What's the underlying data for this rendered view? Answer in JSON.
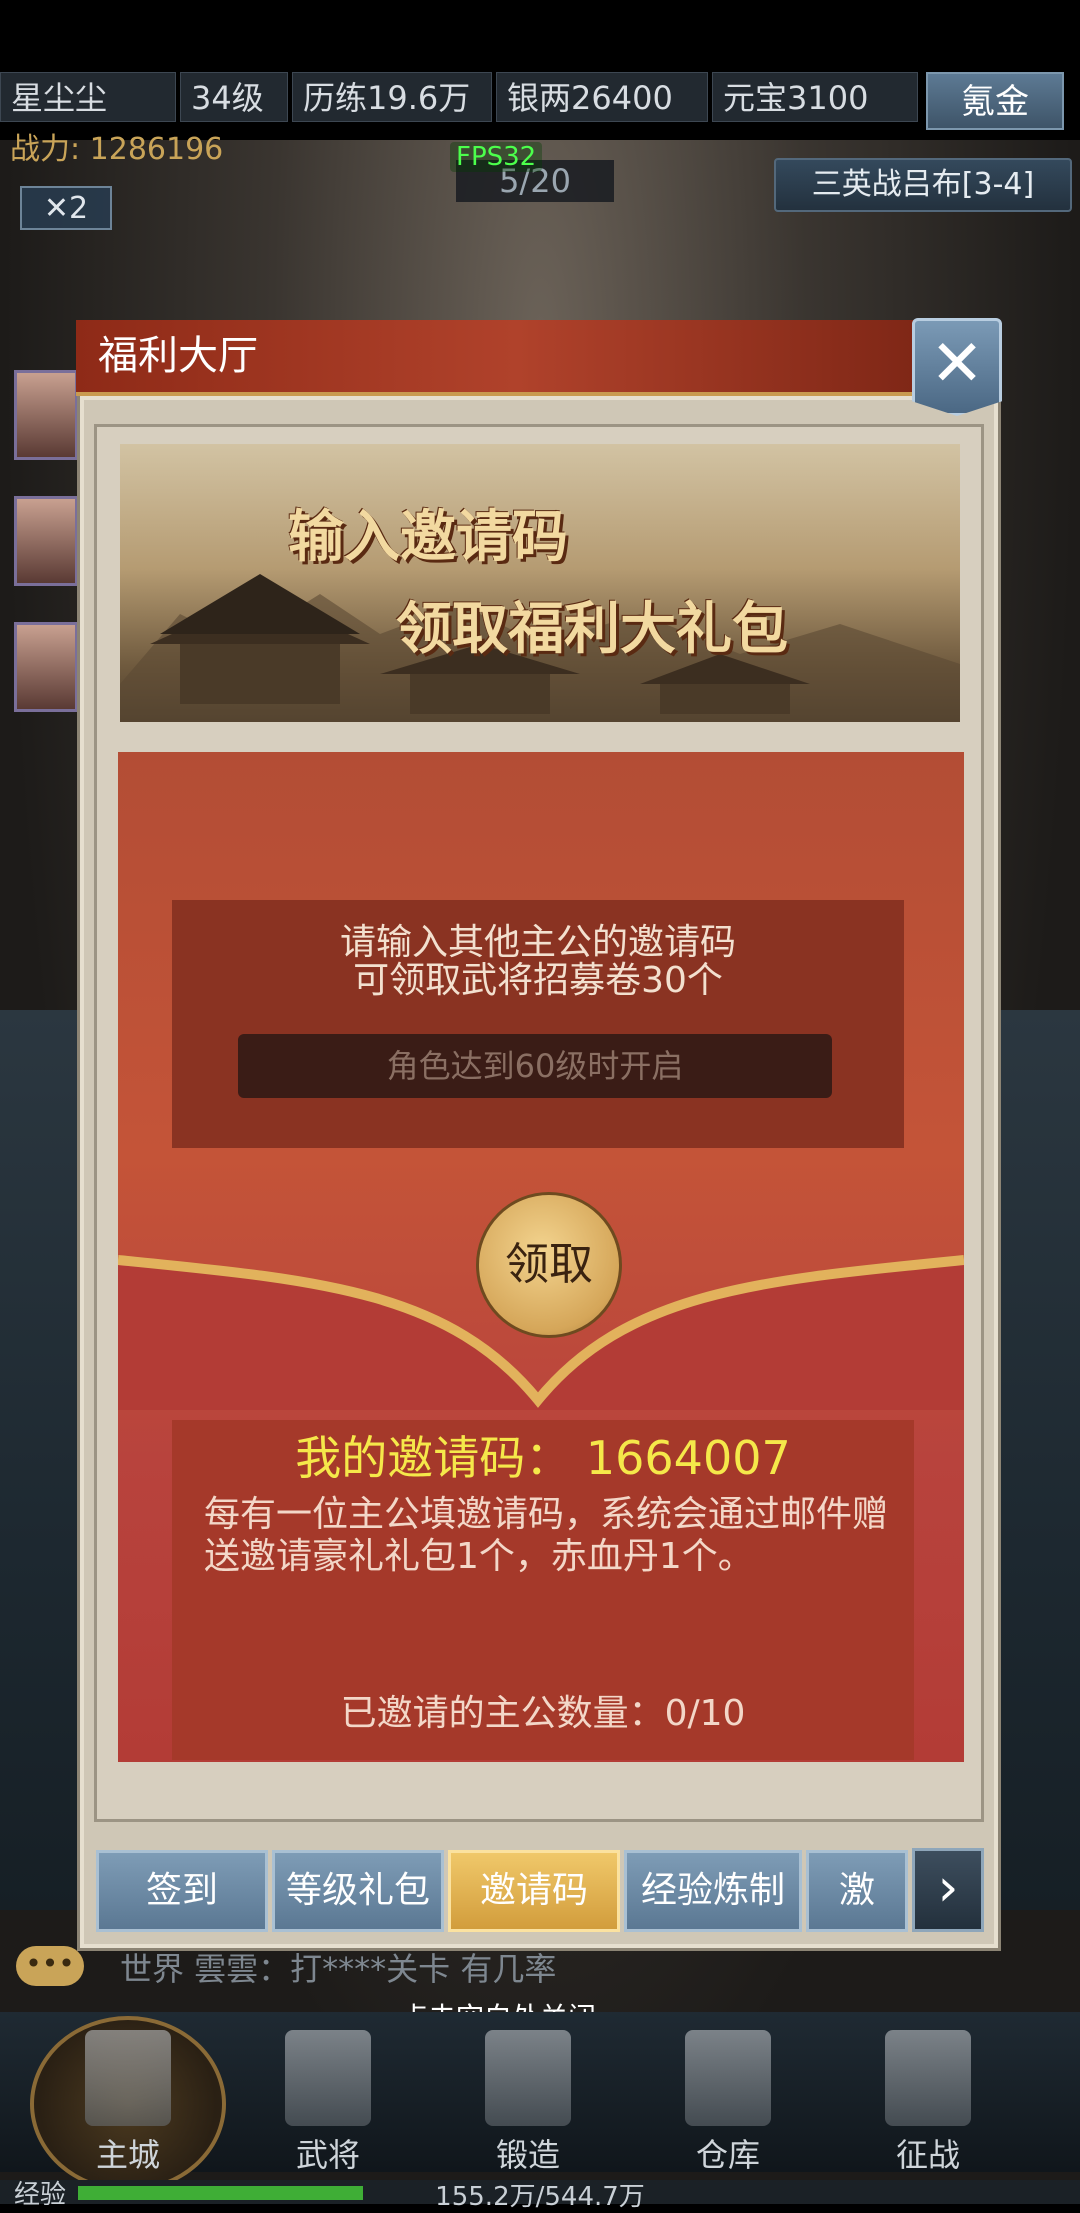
{
  "topbar": {
    "player_name": "星尘尘",
    "level": "34级",
    "experience": "历练19.6万",
    "silver": "银两26400",
    "yuanbao": "元宝3100",
    "recharge_label": "氪金",
    "power": "战力: 1286196",
    "fps": "FPS32"
  },
  "battle": {
    "progress": "5/20",
    "speed": "✕2",
    "stage": "三英战吕布[3-4]"
  },
  "dialog": {
    "title": "福利大厅",
    "close_icon": "close-icon",
    "banner_line1": "输入邀请码",
    "banner_line2": "领取福利大礼包",
    "hint_line1": "请输入其他主公的邀请码",
    "hint_line2": "可领取武将招募卷30个",
    "code_input_placeholder": "角色达到60级时开启",
    "claim_label": "领取",
    "my_code": "我的邀请码：  1664007",
    "description": "每有一位主公填邀请码，系统会通过邮件赠送邀请豪礼礼包1个，赤血丹1个。",
    "invited_count": "已邀请的主公数量：0/10"
  },
  "tabs": [
    {
      "label": "签到",
      "active": false
    },
    {
      "label": "等级礼包",
      "active": false
    },
    {
      "label": "邀请码",
      "active": true
    },
    {
      "label": "经验炼制",
      "active": false
    },
    {
      "label": "激活",
      "active": false
    }
  ],
  "tab_next_icon": "chevron-right-icon",
  "chat": {
    "channel_icon": "chat-bubble-icon",
    "text": "世界  雲雲：打****关卡 有几率"
  },
  "close_hint": "点击空白处关闭",
  "bottom_nav": [
    {
      "label": "主城",
      "icon": "city-icon"
    },
    {
      "label": "武将",
      "icon": "helmet-icon"
    },
    {
      "label": "锻造",
      "icon": "anvil-icon"
    },
    {
      "label": "仓库",
      "icon": "warehouse-icon"
    },
    {
      "label": "征战",
      "icon": "sword-icon"
    }
  ],
  "exp": {
    "label": "经验",
    "value": "155.2万/544.7万",
    "fraction": 0.285
  },
  "colors": {
    "dialog_red": "#c45438",
    "active_tab": "#d29d3c",
    "my_code_yellow": "#f5e84a"
  }
}
